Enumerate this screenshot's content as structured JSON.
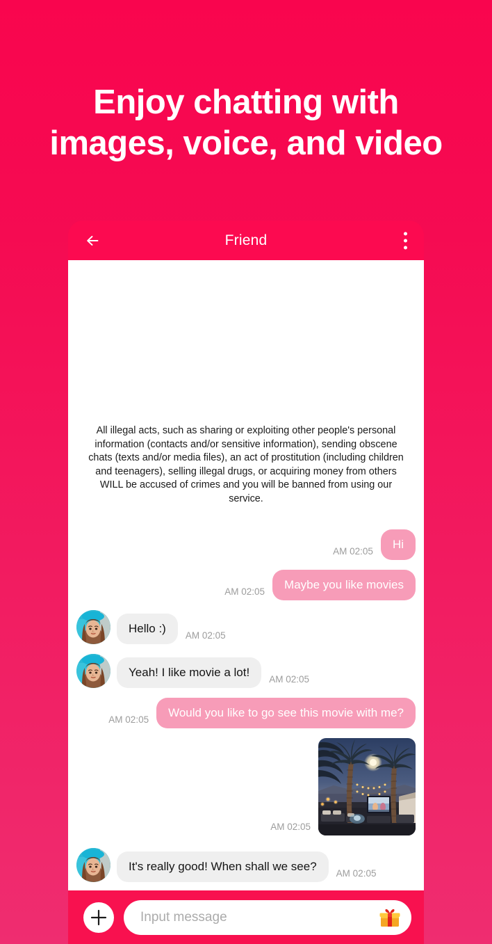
{
  "headline": {
    "line1": "Enjoy chatting with",
    "line2": "images, voice, and video"
  },
  "colors": {
    "background_top": "#F9054E",
    "background_bottom": "#EF2D70",
    "header_bar": "#FC0A50",
    "outgoing_bubble": "#F79CB8",
    "incoming_bubble": "#EFEFEF",
    "timestamp_text": "#9C9C9C",
    "input_bar": "#F8114F"
  },
  "chat_header": {
    "title": "Friend",
    "back_icon": "back-arrow-icon",
    "menu_icon": "overflow-menu-icon"
  },
  "notice": "All illegal acts, such as sharing or exploiting other people's personal information (contacts and/or sensitive information), sending obscene chats (texts and/or media files), an act of prostitution (including children and teenagers), selling illegal drugs, or acquiring money from others WILL be accused of crimes and you will be banned from using our service.",
  "messages": [
    {
      "id": 0,
      "direction": "out",
      "type": "text",
      "text": "Hi",
      "time": "AM 02:05"
    },
    {
      "id": 1,
      "direction": "out",
      "type": "text",
      "text": "Maybe you like movies",
      "time": "AM 02:05"
    },
    {
      "id": 2,
      "direction": "in",
      "type": "text",
      "text": "Hello :)",
      "time": "AM 02:05",
      "avatar": "friend-avatar"
    },
    {
      "id": 3,
      "direction": "in",
      "type": "text",
      "text": "Yeah! I like movie a lot!",
      "time": "AM 02:05",
      "avatar": "friend-avatar"
    },
    {
      "id": 4,
      "direction": "out",
      "type": "text",
      "text": "Would you like to go see this movie with me?",
      "time": "AM 02:05"
    },
    {
      "id": 5,
      "direction": "out",
      "type": "image",
      "text": "",
      "time": "AM 02:05",
      "image_alt": "outdoor movie screening at dusk with palm trees and string lights"
    },
    {
      "id": 6,
      "direction": "in",
      "type": "text",
      "text": "It's really good! When shall we see?",
      "time": "AM 02:05",
      "avatar": "friend-avatar"
    }
  ],
  "input_bar": {
    "add_label": "+",
    "placeholder": "Input message",
    "value": "",
    "gift_icon": "gift-icon",
    "plus_icon": "plus-icon"
  }
}
